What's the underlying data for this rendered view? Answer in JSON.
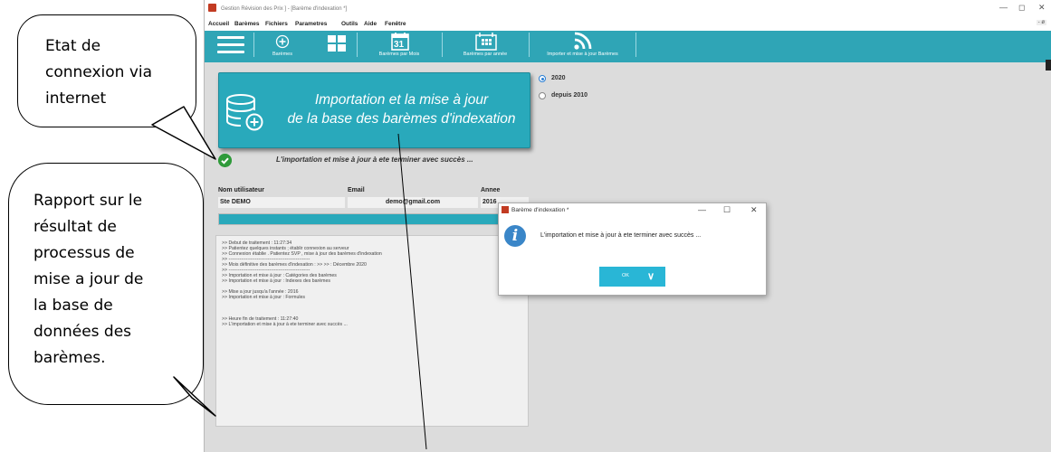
{
  "window": {
    "title": "Gestion Révision des Prix  ] - [Barème d'indexation *]",
    "minimize": "—",
    "maximize": "◻",
    "close": "✕"
  },
  "menu": [
    "Accueil",
    "Barèmes",
    "Fichiers",
    "Parametres",
    "Outils",
    "Aide",
    "Fenêtre"
  ],
  "menu_mdi": "- ø",
  "toolbar": {
    "items": [
      {
        "label": "Barèmes",
        "icon": "add-circle-icon"
      },
      {
        "label": "Barèmes par Mois",
        "icon": "calendar-icon",
        "icon_text": "31"
      },
      {
        "label": "Barèmes par année",
        "icon": "calendar-grid-icon"
      },
      {
        "label": "Importer et mise à jour Barèmes",
        "icon": "rss-icon"
      }
    ]
  },
  "main": {
    "import_button": {
      "line1": "Importation et la mise à jour",
      "line2": "de la base des barèmes d'indexation",
      "icon": "database-add-icon"
    },
    "status_message": "L'importation et mise à jour à ete  terminer  avec succès ...",
    "radios": [
      {
        "label": "2020",
        "selected": true
      },
      {
        "label": "depuis 2010",
        "selected": false
      }
    ],
    "fields": {
      "user_label": "Nom utilisateur",
      "user_value": "Ste DEMO",
      "email_label": "Email",
      "email_value": "demo@gmail.com",
      "year_label": "Annee",
      "year_value": "2016"
    },
    "progress": 1.0,
    "log": [
      ">>  Debut de traitement  :  11:27:34",
      ">>  Patientez quelques instants ; établir connexion au serveur",
      ">>  Connexion établie . Patientez SVP , mise à jour  des barèmes d'indexation",
      ">>  ----------------------------------------------------",
      ">>  Mois définitive des barèmes d'indexation : >> >>  :  Décembre 2020",
      ">>  ----------------------------------------------------",
      ">>  Importation et mise à  jour  :  Catégories des barèmes",
      ">>  Importation et mise à  jour  :  Indexes des barèmes",
      "",
      ">>  Mise a jour jusqu'a l'année  :  2016",
      ">>  Importation et mise à  jour  :  Formules",
      "",
      "",
      "",
      ">>  Heure  fin  de traitement  :  11:27:40",
      ">>  L'importation et mise à jour  à ete  terminer  avec succès ..."
    ]
  },
  "dialog": {
    "title": "Barème d'indexation *",
    "message": "L'importation et mise à jour  à ete  terminer  avec succès ...",
    "ok_label": "OK",
    "minimize": "—",
    "maximize": "☐",
    "close": "✕"
  },
  "annotations": {
    "bubble1": [
      "Etat de",
      "connexion via",
      "internet"
    ],
    "bubble2": [
      "Rapport sur le",
      "résultat de",
      "processus de",
      "mise a jour de",
      "la base de",
      "données des",
      "barèmes."
    ]
  },
  "colors": {
    "accent": "#2fa5b6",
    "button": "#29a9bb",
    "success": "#2f9a3a",
    "dialog_ok": "#29b6d6",
    "info": "#3a86c8"
  }
}
